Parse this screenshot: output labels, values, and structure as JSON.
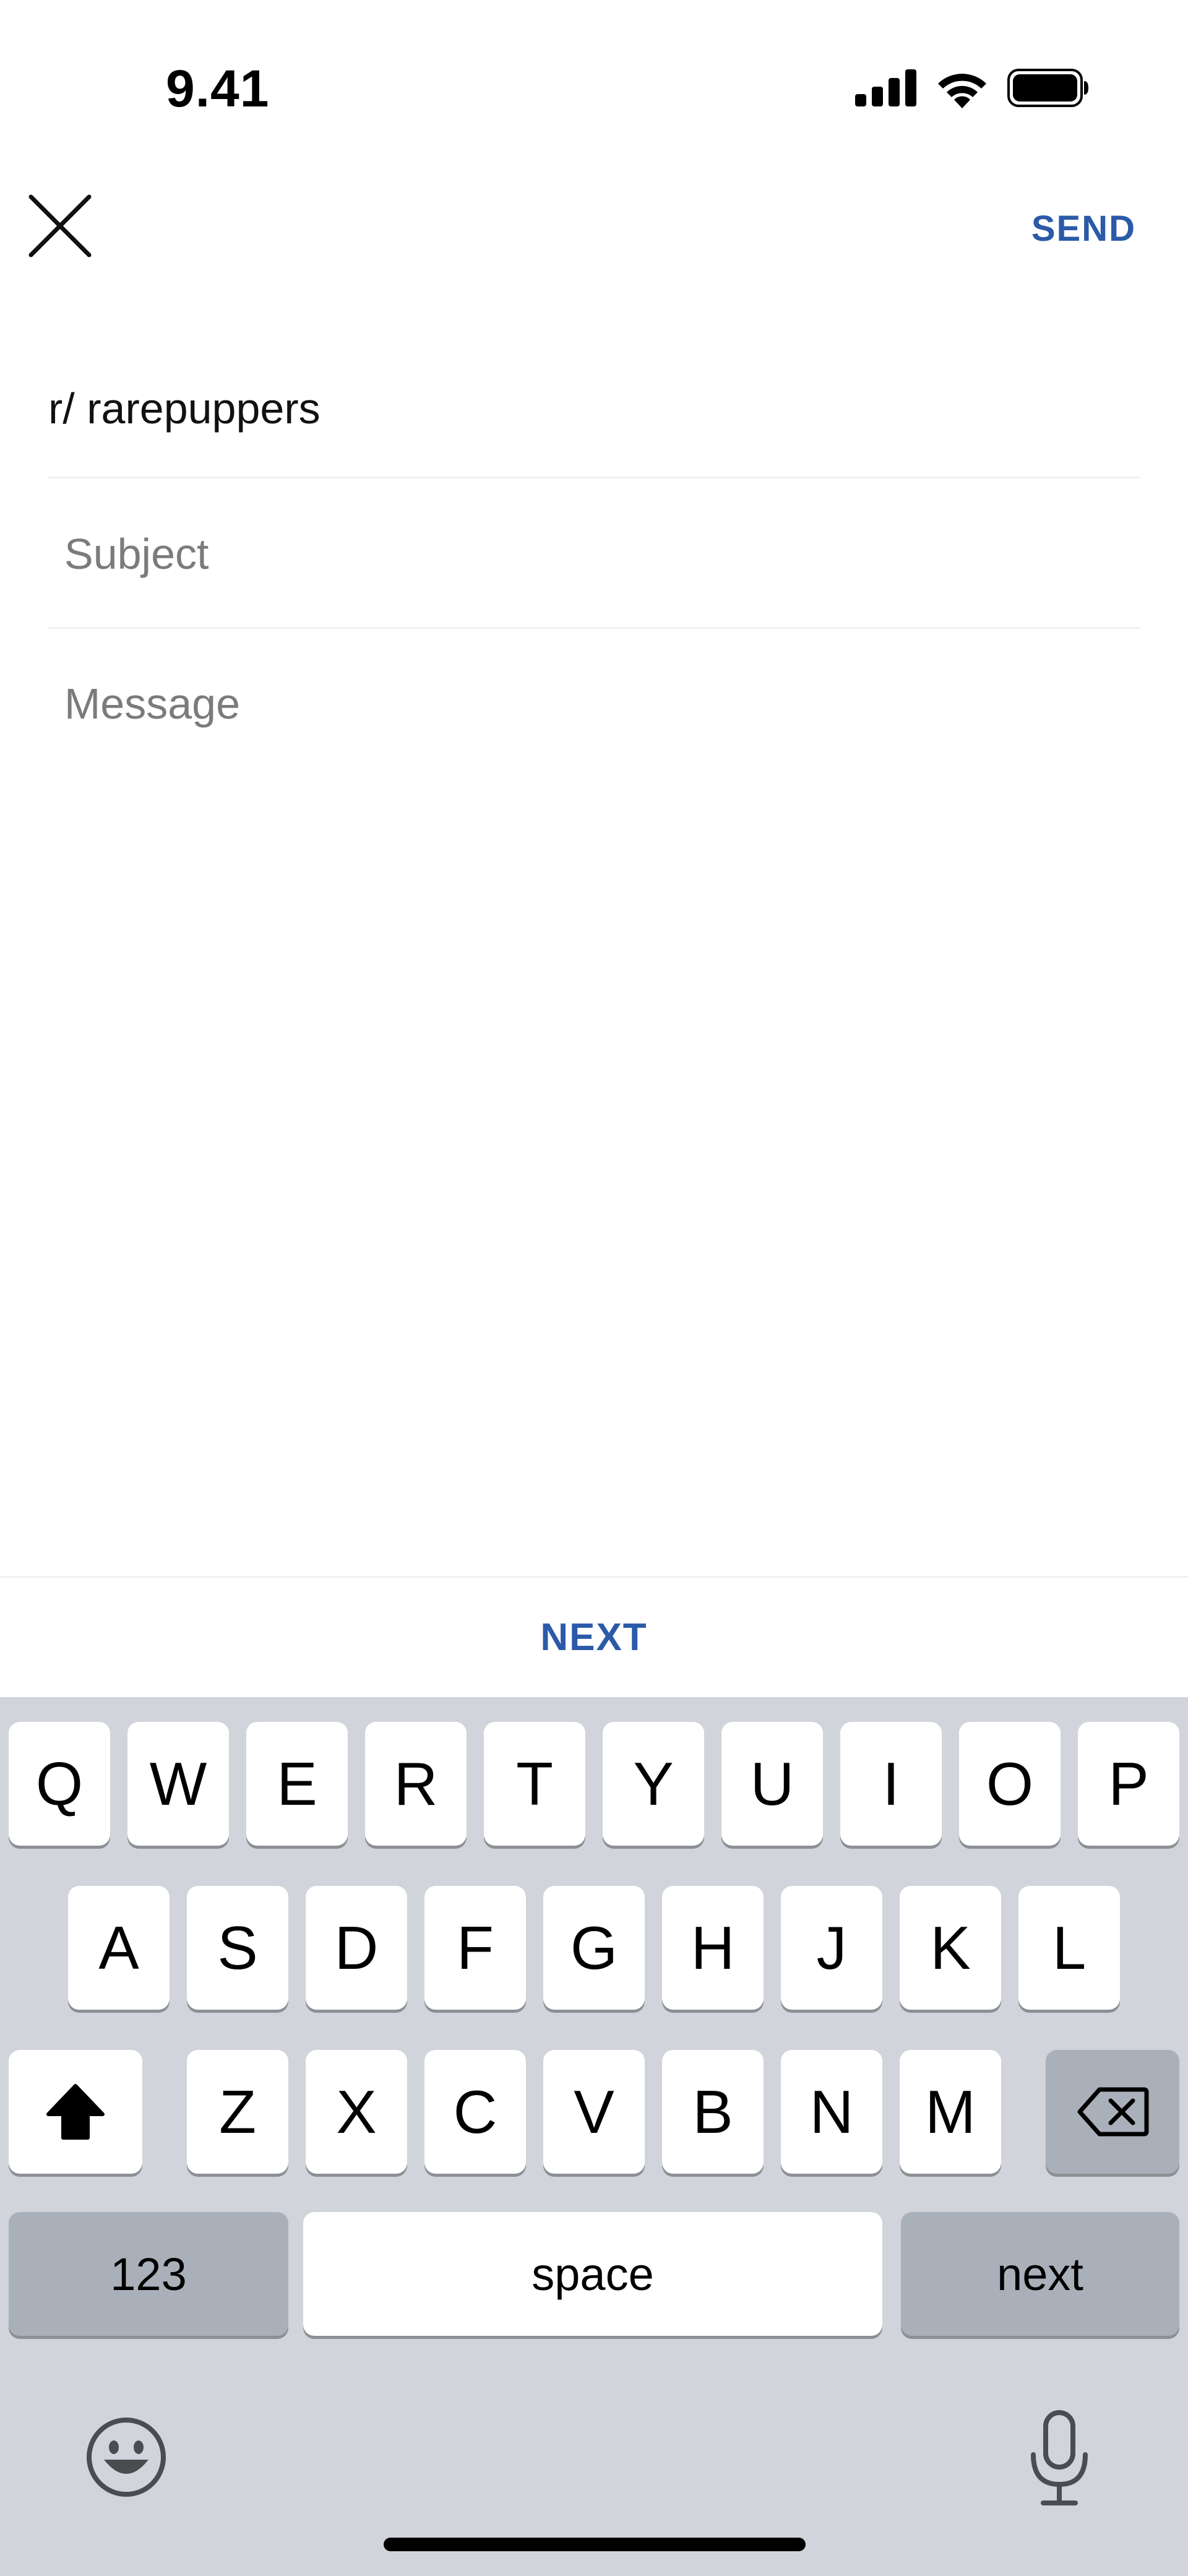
{
  "status_bar": {
    "time": "9.41",
    "icons": [
      "signal-icon",
      "wifi-icon",
      "battery-icon"
    ]
  },
  "header": {
    "close_icon": "close-icon",
    "send_label": "SEND",
    "accent_color": "#2b5aa8"
  },
  "compose": {
    "recipient": "r/ rarepuppers",
    "subject": {
      "value": "",
      "placeholder": "Subject"
    },
    "message": {
      "value": "",
      "placeholder": "Message"
    }
  },
  "next_bar": {
    "label": "NEXT"
  },
  "keyboard": {
    "row1": [
      "Q",
      "W",
      "E",
      "R",
      "T",
      "Y",
      "U",
      "I",
      "O",
      "P"
    ],
    "row2": [
      "A",
      "S",
      "D",
      "F",
      "G",
      "H",
      "J",
      "K",
      "L"
    ],
    "row3": [
      "Z",
      "X",
      "C",
      "V",
      "B",
      "N",
      "M"
    ],
    "shift_icon": "shift-icon",
    "backspace_icon": "backspace-icon",
    "numbers_label": "123",
    "space_label": "space",
    "return_label": "next",
    "emoji_icon": "emoji-icon",
    "mic_icon": "microphone-icon"
  }
}
